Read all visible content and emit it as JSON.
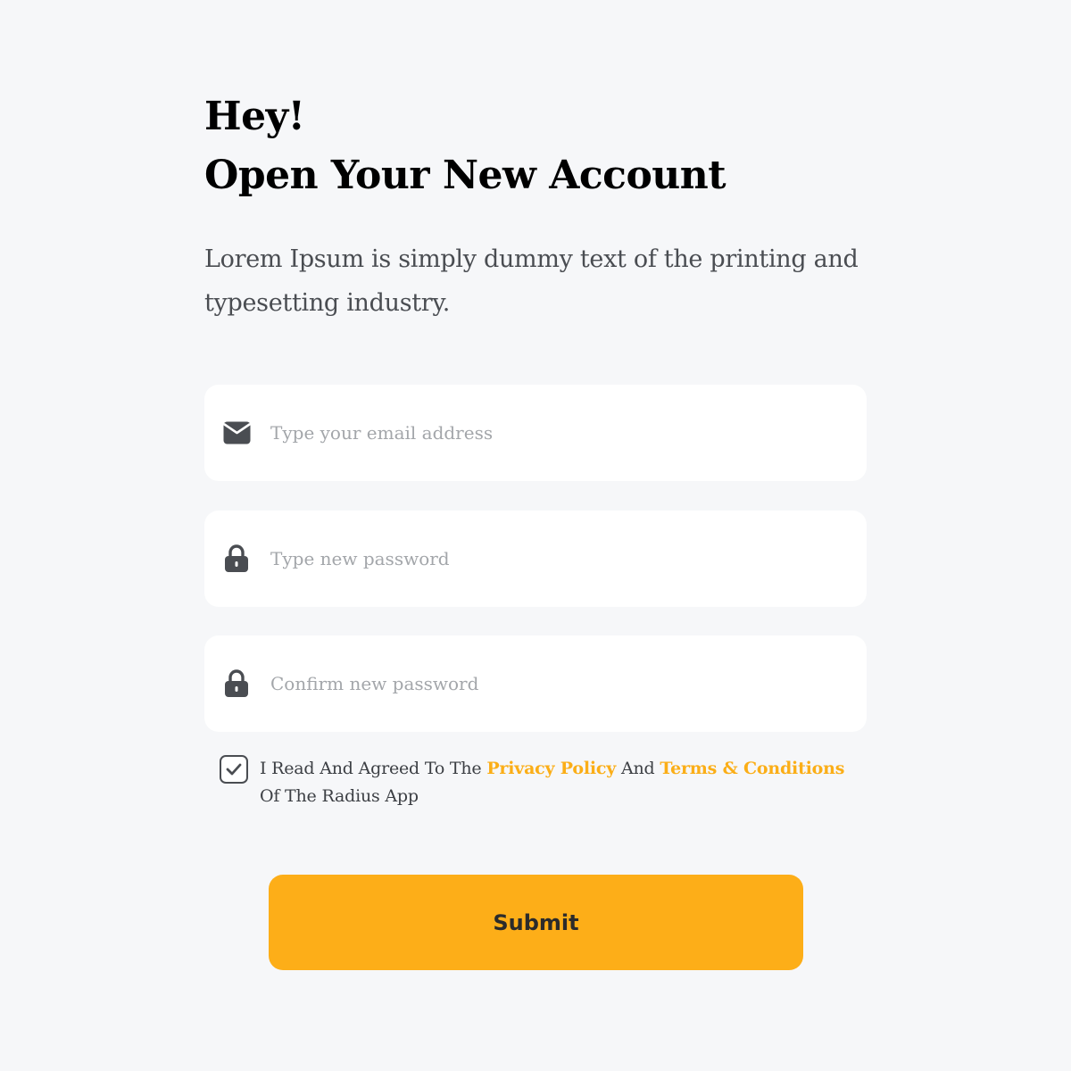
{
  "header": {
    "greeting": "Hey!",
    "title": "Open Your New Account",
    "subtitle": "Lorem Ipsum is simply dummy text of the printing and typesetting industry."
  },
  "form": {
    "email": {
      "placeholder": "Type your email address",
      "value": "",
      "icon": "envelope-icon"
    },
    "password": {
      "placeholder": "Type new password",
      "value": "",
      "icon": "lock-icon"
    },
    "confirm_password": {
      "placeholder": "Confirm new password",
      "value": "",
      "icon": "lock-icon"
    },
    "agreement": {
      "checked": true,
      "text_before": "I Read And Agreed To The ",
      "privacy_link": "Privacy Policy",
      "text_middle": " And ",
      "terms_link": "Terms & Conditions",
      "text_after": " Of The Radius App"
    },
    "submit_label": "Submit"
  },
  "colors": {
    "background": "#f6f7f9",
    "accent": "#fdae18",
    "link": "#fbae17",
    "icon": "#4a4d52"
  }
}
